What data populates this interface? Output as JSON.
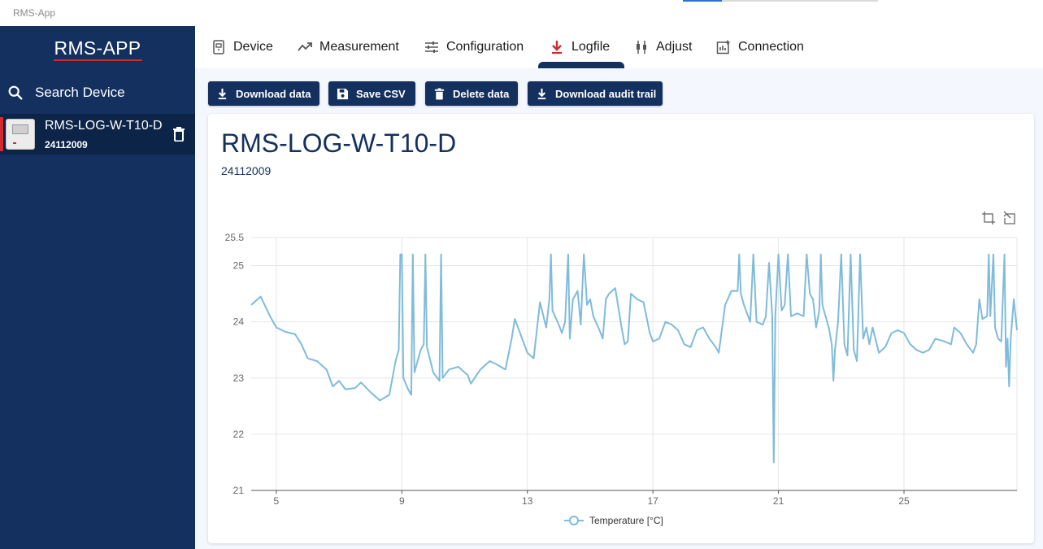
{
  "window": {
    "title": "RMS-App"
  },
  "sidebar": {
    "brand": "RMS-APP",
    "search_label": "Search Device",
    "device": {
      "name": "RMS-LOG-W-T10-D",
      "serial": "24112009"
    }
  },
  "tabs": [
    {
      "label": "Device",
      "icon": "device-icon"
    },
    {
      "label": "Measurement",
      "icon": "trend-icon"
    },
    {
      "label": "Configuration",
      "icon": "sliders-icon"
    },
    {
      "label": "Logfile",
      "icon": "download-icon",
      "active": true
    },
    {
      "label": "Adjust",
      "icon": "adjust-icon"
    },
    {
      "label": "Connection",
      "icon": "chart-plus-icon"
    }
  ],
  "toolbar": {
    "download_data": "Download data",
    "save_csv": "Save CSV",
    "delete_data": "Delete data",
    "download_audit": "Download audit trail"
  },
  "card": {
    "title": "RMS-LOG-W-T10-D",
    "serial": "24112009"
  },
  "colors": {
    "brand": "#14305f",
    "accent": "#d12a2f",
    "line": "#7fbbdb",
    "background": "#f4f7fd"
  },
  "chart_data": {
    "type": "line",
    "xlabel": "",
    "ylabel": "",
    "xlim": [
      4.2,
      28.6
    ],
    "ylim": [
      21,
      25.5
    ],
    "x_ticks": [
      5,
      9,
      13,
      17,
      21,
      25
    ],
    "y_ticks": [
      21,
      22,
      23,
      24,
      25,
      25.5
    ],
    "grid": true,
    "legend_position": "bottom",
    "series": [
      {
        "name": "Temperature [°C]",
        "color": "#7fbbdb",
        "points": [
          [
            4.2,
            24.3
          ],
          [
            4.5,
            24.45
          ],
          [
            4.8,
            24.1
          ],
          [
            5.0,
            23.9
          ],
          [
            5.3,
            23.82
          ],
          [
            5.6,
            23.78
          ],
          [
            5.8,
            23.6
          ],
          [
            6.0,
            23.35
          ],
          [
            6.3,
            23.3
          ],
          [
            6.6,
            23.15
          ],
          [
            6.8,
            22.85
          ],
          [
            7.0,
            22.95
          ],
          [
            7.2,
            22.8
          ],
          [
            7.5,
            22.82
          ],
          [
            7.7,
            22.92
          ],
          [
            8.0,
            22.75
          ],
          [
            8.3,
            22.6
          ],
          [
            8.6,
            22.7
          ],
          [
            8.8,
            23.3
          ],
          [
            8.9,
            23.5
          ],
          [
            8.95,
            25.2
          ],
          [
            9.0,
            25.2
          ],
          [
            9.05,
            23.0
          ],
          [
            9.2,
            22.8
          ],
          [
            9.3,
            22.7
          ],
          [
            9.35,
            25.2
          ],
          [
            9.4,
            23.1
          ],
          [
            9.6,
            23.5
          ],
          [
            9.7,
            23.6
          ],
          [
            9.75,
            25.2
          ],
          [
            9.8,
            23.55
          ],
          [
            10.0,
            23.1
          ],
          [
            10.2,
            22.95
          ],
          [
            10.25,
            25.2
          ],
          [
            10.3,
            23.0
          ],
          [
            10.5,
            23.15
          ],
          [
            10.8,
            23.2
          ],
          [
            11.1,
            23.05
          ],
          [
            11.2,
            22.9
          ],
          [
            11.5,
            23.15
          ],
          [
            11.8,
            23.3
          ],
          [
            12.0,
            23.25
          ],
          [
            12.3,
            23.15
          ],
          [
            12.5,
            23.7
          ],
          [
            12.6,
            24.05
          ],
          [
            12.8,
            23.75
          ],
          [
            13.0,
            23.45
          ],
          [
            13.2,
            23.35
          ],
          [
            13.4,
            24.35
          ],
          [
            13.6,
            23.9
          ],
          [
            13.7,
            24.4
          ],
          [
            13.75,
            25.2
          ],
          [
            13.8,
            24.2
          ],
          [
            14.0,
            23.95
          ],
          [
            14.1,
            23.8
          ],
          [
            14.2,
            24.0
          ],
          [
            14.3,
            25.2
          ],
          [
            14.35,
            23.7
          ],
          [
            14.45,
            24.4
          ],
          [
            14.6,
            24.55
          ],
          [
            14.7,
            23.95
          ],
          [
            14.8,
            25.2
          ],
          [
            14.9,
            24.3
          ],
          [
            15.0,
            24.4
          ],
          [
            15.1,
            24.1
          ],
          [
            15.3,
            23.85
          ],
          [
            15.4,
            23.7
          ],
          [
            15.5,
            24.4
          ],
          [
            15.6,
            24.5
          ],
          [
            15.8,
            24.6
          ],
          [
            16.0,
            23.9
          ],
          [
            16.1,
            23.6
          ],
          [
            16.2,
            23.65
          ],
          [
            16.3,
            24.5
          ],
          [
            16.5,
            24.4
          ],
          [
            16.7,
            24.35
          ],
          [
            16.9,
            23.8
          ],
          [
            17.0,
            23.65
          ],
          [
            17.2,
            23.7
          ],
          [
            17.4,
            24.0
          ],
          [
            17.6,
            23.95
          ],
          [
            17.8,
            23.85
          ],
          [
            18.0,
            23.6
          ],
          [
            18.2,
            23.55
          ],
          [
            18.4,
            23.85
          ],
          [
            18.6,
            23.9
          ],
          [
            18.8,
            23.7
          ],
          [
            19.0,
            23.55
          ],
          [
            19.1,
            23.45
          ],
          [
            19.3,
            24.3
          ],
          [
            19.5,
            24.55
          ],
          [
            19.7,
            24.55
          ],
          [
            19.75,
            25.2
          ],
          [
            19.8,
            24.5
          ],
          [
            19.9,
            24.3
          ],
          [
            20.1,
            24.0
          ],
          [
            20.2,
            25.2
          ],
          [
            20.3,
            24.0
          ],
          [
            20.5,
            23.95
          ],
          [
            20.6,
            24.1
          ],
          [
            20.7,
            25.05
          ],
          [
            20.8,
            24.1
          ],
          [
            20.85,
            21.5
          ],
          [
            20.9,
            24.1
          ],
          [
            21.0,
            25.2
          ],
          [
            21.1,
            24.2
          ],
          [
            21.2,
            24.3
          ],
          [
            21.3,
            25.2
          ],
          [
            21.4,
            24.1
          ],
          [
            21.6,
            24.15
          ],
          [
            21.8,
            24.1
          ],
          [
            21.9,
            25.2
          ],
          [
            22.0,
            24.5
          ],
          [
            22.1,
            24.4
          ],
          [
            22.2,
            23.9
          ],
          [
            22.3,
            24.2
          ],
          [
            22.35,
            25.2
          ],
          [
            22.4,
            24.3
          ],
          [
            22.6,
            23.9
          ],
          [
            22.7,
            23.6
          ],
          [
            22.75,
            22.95
          ],
          [
            22.8,
            23.5
          ],
          [
            22.9,
            24.0
          ],
          [
            23.0,
            25.2
          ],
          [
            23.1,
            23.6
          ],
          [
            23.2,
            23.4
          ],
          [
            23.3,
            25.2
          ],
          [
            23.4,
            23.5
          ],
          [
            23.5,
            23.3
          ],
          [
            23.6,
            25.2
          ],
          [
            23.7,
            23.7
          ],
          [
            23.8,
            23.9
          ],
          [
            23.9,
            23.6
          ],
          [
            24.0,
            23.9
          ],
          [
            24.2,
            23.45
          ],
          [
            24.4,
            23.55
          ],
          [
            24.6,
            23.8
          ],
          [
            24.8,
            23.85
          ],
          [
            25.0,
            23.8
          ],
          [
            25.2,
            23.6
          ],
          [
            25.4,
            23.5
          ],
          [
            25.6,
            23.45
          ],
          [
            25.8,
            23.5
          ],
          [
            26.0,
            23.7
          ],
          [
            26.3,
            23.65
          ],
          [
            26.5,
            23.6
          ],
          [
            26.6,
            23.9
          ],
          [
            26.8,
            23.8
          ],
          [
            27.0,
            23.6
          ],
          [
            27.2,
            23.45
          ],
          [
            27.3,
            23.6
          ],
          [
            27.4,
            24.4
          ],
          [
            27.5,
            24.05
          ],
          [
            27.65,
            24.1
          ],
          [
            27.7,
            25.2
          ],
          [
            27.75,
            24.1
          ],
          [
            27.85,
            25.2
          ],
          [
            27.9,
            23.9
          ],
          [
            28.0,
            23.7
          ],
          [
            28.1,
            23.65
          ],
          [
            28.2,
            25.2
          ],
          [
            28.25,
            23.2
          ],
          [
            28.3,
            23.7
          ],
          [
            28.35,
            22.85
          ],
          [
            28.4,
            23.7
          ],
          [
            28.5,
            24.4
          ],
          [
            28.6,
            23.85
          ]
        ]
      }
    ]
  }
}
